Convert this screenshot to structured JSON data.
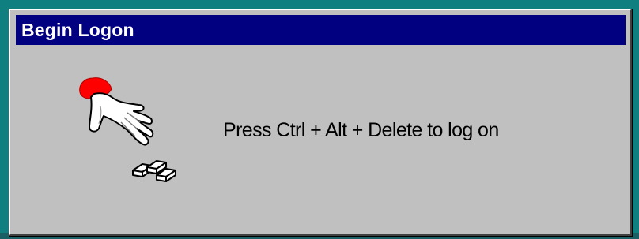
{
  "window": {
    "title": "Begin Logon",
    "message": "Press Ctrl + Alt + Delete to log on"
  },
  "icons": {
    "hand": "hand-pressing-icon",
    "keys": "keyboard-keys-icon"
  },
  "colors": {
    "desktop": "#0f7f80",
    "titlebar": "#000080",
    "title_text": "#ffffff",
    "window_face": "#c0c0c0",
    "cuff": "#ff0000"
  }
}
